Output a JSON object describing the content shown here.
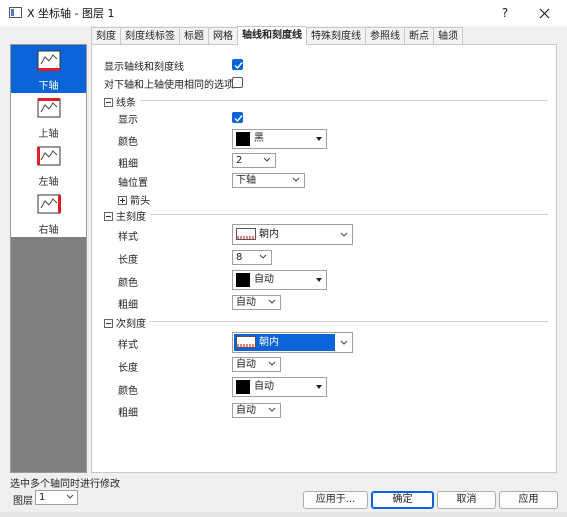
{
  "window": {
    "title": "X 坐标轴 - 图层 1",
    "help": "?",
    "close_icon": "close-icon"
  },
  "tabs": [
    "刻度",
    "刻度线标签",
    "标题",
    "网格",
    "轴线和刻度线",
    "特殊刻度线",
    "参照线",
    "断点",
    "轴须"
  ],
  "active_tab": "轴线和刻度线",
  "axis_list": [
    {
      "label": "下轴",
      "selected": true,
      "icon": "bottom-axis-icon"
    },
    {
      "label": "上轴",
      "selected": false,
      "icon": "top-axis-icon"
    },
    {
      "label": "左轴",
      "selected": false,
      "icon": "left-axis-icon"
    },
    {
      "label": "右轴",
      "selected": false,
      "icon": "right-axis-icon"
    }
  ],
  "options": {
    "show_axis_ticks_label": "显示轴线和刻度线",
    "show_axis_ticks_checked": true,
    "same_options_label": "对下轴和上轴使用相同的选项",
    "same_options_checked": false
  },
  "line_group": {
    "header": "线条",
    "show_label": "显示",
    "show_checked": true,
    "color_label": "颜色",
    "color_value": "黑",
    "color_hex": "#000000",
    "thickness_label": "粗细",
    "thickness_value": "2",
    "axis_pos_label": "轴位置",
    "axis_pos_value": "下轴",
    "arrow_header": "箭头"
  },
  "major_group": {
    "header": "主刻度",
    "style_label": "样式",
    "style_value": "朝内",
    "length_label": "长度",
    "length_value": "8",
    "color_label": "颜色",
    "color_value": "自动",
    "color_hex": "#000000",
    "thickness_label": "粗细",
    "thickness_value": "自动"
  },
  "minor_group": {
    "header": "次刻度",
    "style_label": "样式",
    "style_value": "朝内",
    "length_label": "长度",
    "length_value": "自动",
    "color_label": "颜色",
    "color_value": "自动",
    "color_hex": "#000000",
    "thickness_label": "粗细",
    "thickness_value": "自动"
  },
  "footer": {
    "status": "选中多个轴同时进行修改",
    "layer_label": "图层",
    "layer_value": "1",
    "apply_to": "应用于...",
    "ok": "确定",
    "cancel": "取消",
    "apply": "应用"
  },
  "colors": {
    "accent": "#0a64d8",
    "left_panel_bg": "#808080"
  }
}
